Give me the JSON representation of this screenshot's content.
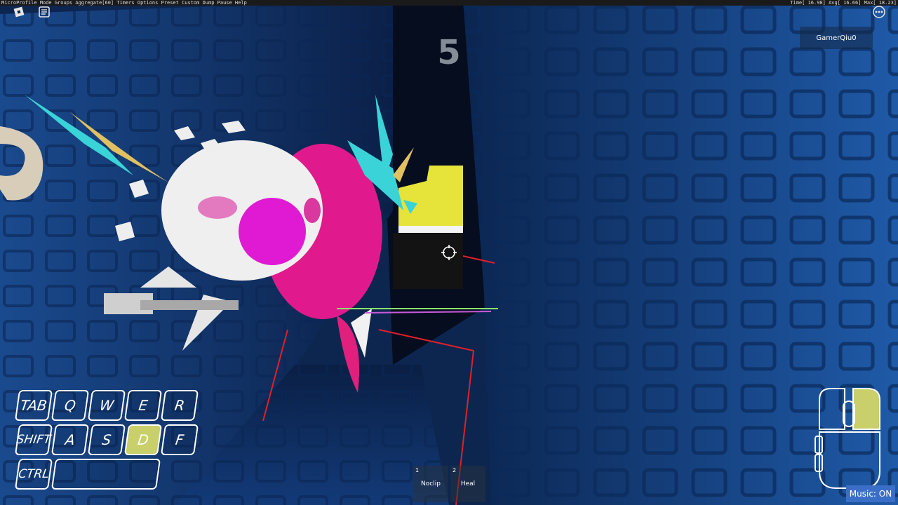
{
  "profiler": {
    "left_text": "MicroProfile   Mode Groups Aggregate[60] Timers Options Preset Custom Dump Pause Help",
    "right_text": "Time[ 16.98] Avg[ 16.66] Max[ 18.23]"
  },
  "icons": {
    "roblox_menu": "roblox-logo-icon",
    "chat": "chat-icon",
    "more": "more-menu-icon",
    "crosshair": "crosshair-icon",
    "mouse": "mouse-icon"
  },
  "player": {
    "username": "GamerQiu0"
  },
  "hud": {
    "counter": "5"
  },
  "keys": [
    {
      "label": "TAB",
      "active": false
    },
    {
      "label": "Q",
      "active": false
    },
    {
      "label": "W",
      "active": false
    },
    {
      "label": "E",
      "active": false
    },
    {
      "label": "R",
      "active": false
    },
    {
      "label": "SHIFT",
      "active": false
    },
    {
      "label": "A",
      "active": false
    },
    {
      "label": "S",
      "active": false
    },
    {
      "label": "D",
      "active": true
    },
    {
      "label": "F",
      "active": false
    },
    {
      "label": "CTRL",
      "active": false
    },
    {
      "label": "",
      "active": false
    }
  ],
  "hotbar": [
    {
      "number": "1",
      "label": "Noclip"
    },
    {
      "number": "2",
      "label": "Heal"
    }
  ],
  "music": {
    "label": "Music: ON"
  },
  "colors": {
    "key_active": "#c8cf6b",
    "mouse_active": "#c8cf6b",
    "music_bg": "#3b6fc7",
    "wall_blue": "#1c4a8f"
  }
}
